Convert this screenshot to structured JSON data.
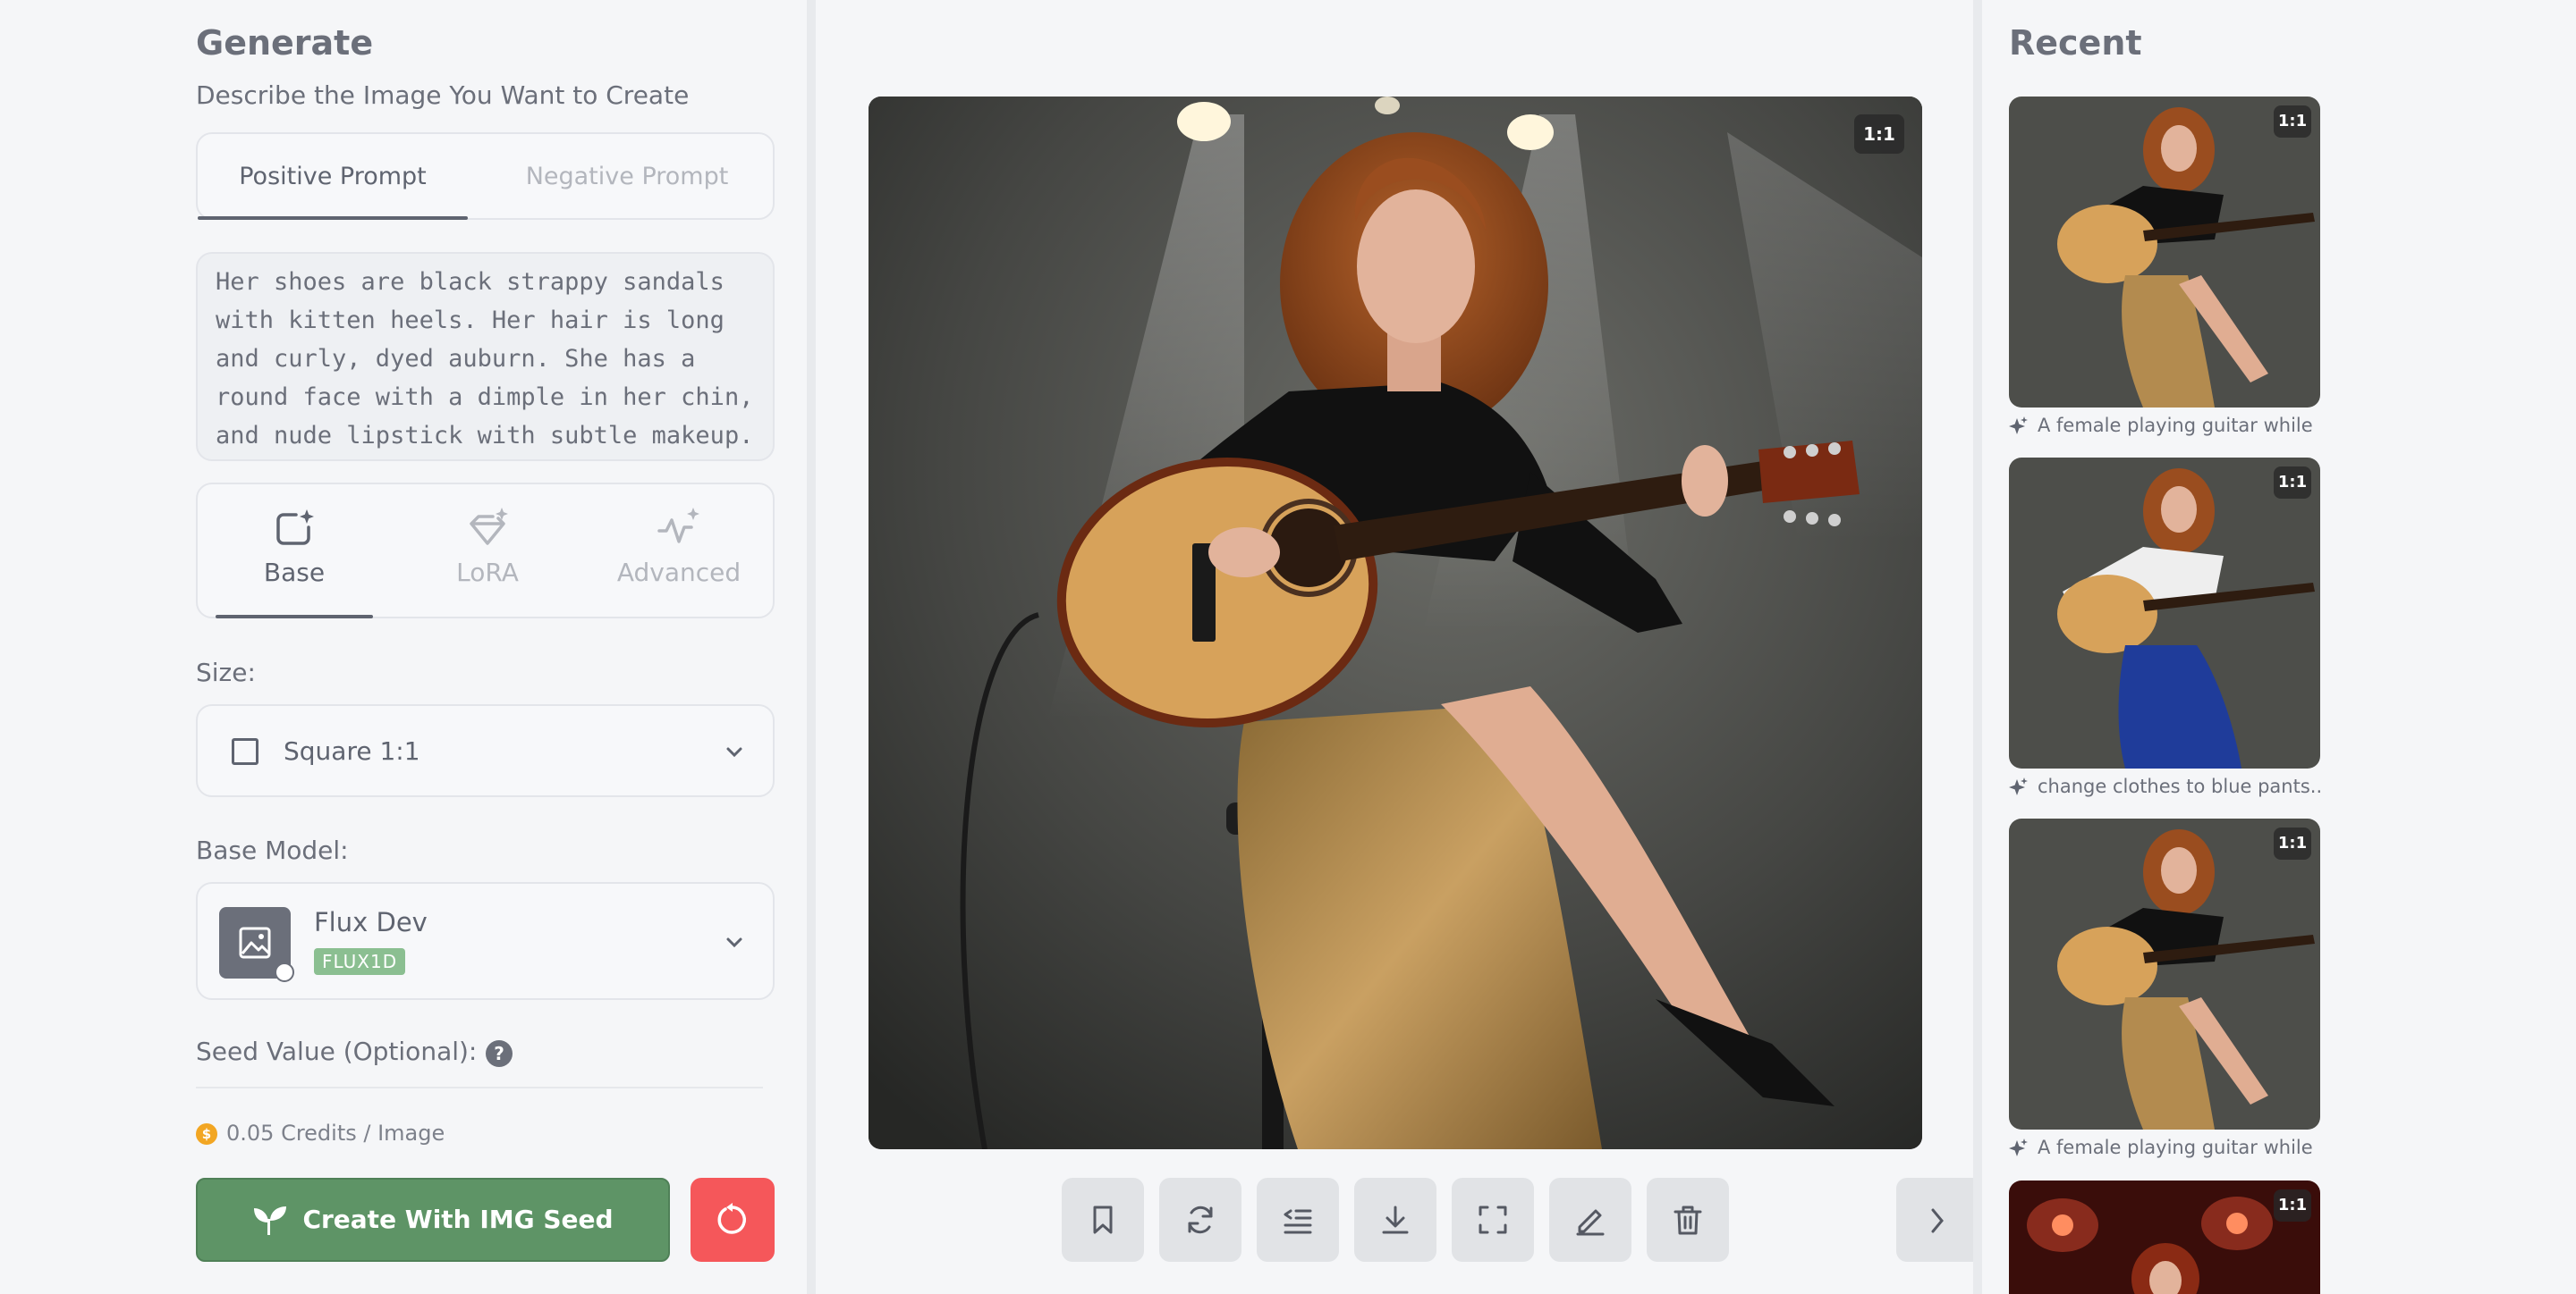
{
  "left": {
    "title": "Generate",
    "subtitle": "Describe the Image You Want to Create",
    "tabs": {
      "positive": "Positive Prompt",
      "negative": "Negative Prompt"
    },
    "prompt_text": "Her shoes are black strappy sandals with kitten heels. Her hair is long and curly, dyed auburn. She has a round face with a dimple in her chin, and nude lipstick with subtle makeup.",
    "modes": {
      "base": "Base",
      "lora": "LoRA",
      "advanced": "Advanced"
    },
    "size_label": "Size:",
    "size_value": "Square 1:1",
    "model_label": "Base Model:",
    "model_name": "Flux Dev",
    "model_tag": "FLUX1D",
    "seed_label": "Seed Value (Optional):",
    "help_glyph": "?",
    "credits": "0.05 Credits / Image",
    "coin_glyph": "$",
    "create_button": "Create With IMG Seed"
  },
  "center": {
    "ratio_badge": "1:1",
    "toolbar": [
      "bookmark-icon",
      "refresh-icon",
      "list-indent-icon",
      "download-icon",
      "fullscreen-icon",
      "edit-icon",
      "trash-icon"
    ]
  },
  "right": {
    "title": "Recent",
    "items": [
      {
        "badge": "1:1",
        "caption": "A female playing guitar while ..."
      },
      {
        "badge": "1:1",
        "caption": "change clothes to blue pants..."
      },
      {
        "badge": "1:1",
        "caption": "A female playing guitar while ..."
      },
      {
        "badge": "1:1",
        "caption": ""
      }
    ]
  },
  "colors": {
    "accent_green": "#5e9466",
    "reset_red": "#f5575a",
    "tag_green": "#8bbf91",
    "coin": "#f2a623"
  }
}
